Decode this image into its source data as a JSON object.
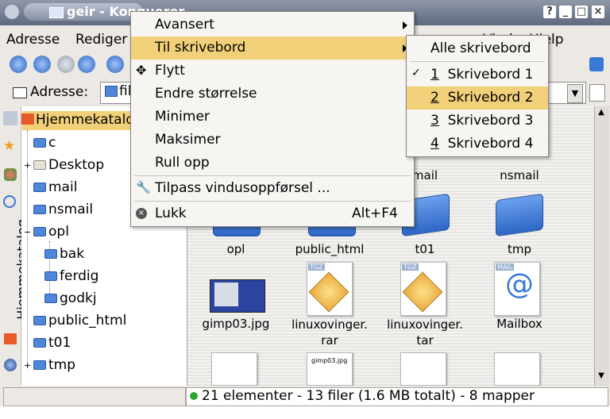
{
  "window": {
    "title": "geir - Konqueror"
  },
  "menubar": {
    "items": [
      "Adresse",
      "Rediger",
      "Vindu",
      "Hjelp"
    ]
  },
  "address": {
    "label": "Adresse:",
    "value": "fil"
  },
  "sidebar": {
    "vertical_tab": "Hjemmekatalog"
  },
  "tree": {
    "root": "Hjemmekatalog",
    "items": [
      "c",
      "Desktop",
      "mail",
      "nsmail",
      "opl",
      "bak",
      "ferdig",
      "godkj",
      "public_html",
      "t01",
      "tmp"
    ]
  },
  "files": {
    "row0": [
      "mail",
      "nsmail"
    ],
    "row1": [
      "opl",
      "public_html",
      "t01",
      "tmp"
    ],
    "row2": [
      "gimp03.jpg",
      "linuxovinger.\nrar",
      "linuxovinger.\ntar",
      "Mailbox"
    ],
    "row3_thumb_caption": "gimp03.jpg",
    "badges": {
      "tgz": "TGZ",
      "mail": "MAIL"
    }
  },
  "status": {
    "text": "21 elementer -  13 filer (1.6 MB totalt) - 8 mapper"
  },
  "window_menu": {
    "items": [
      {
        "label": "Avansert",
        "submenu": true
      },
      {
        "label": "Til skrivebord",
        "submenu": true
      },
      {
        "label": "Flytt"
      },
      {
        "label": "Endre størrelse"
      },
      {
        "label": "Minimer"
      },
      {
        "label": "Maksimer"
      },
      {
        "label": "Rull opp"
      },
      {
        "label": "Tilpass vindusoppførsel ..."
      },
      {
        "label": "Lukk",
        "shortcut": "Alt+F4"
      }
    ]
  },
  "desktop_menu": {
    "all": "Alle skrivebord",
    "items": [
      {
        "num": "1",
        "label": "Skrivebord 1",
        "checked": true
      },
      {
        "num": "2",
        "label": "Skrivebord 2"
      },
      {
        "num": "3",
        "label": "Skrivebord 3"
      },
      {
        "num": "4",
        "label": "Skrivebord 4"
      }
    ]
  },
  "colors": {
    "highlight": "#f2d07a",
    "folder": "#4f86d8",
    "titlebar": "#5f6a80"
  }
}
